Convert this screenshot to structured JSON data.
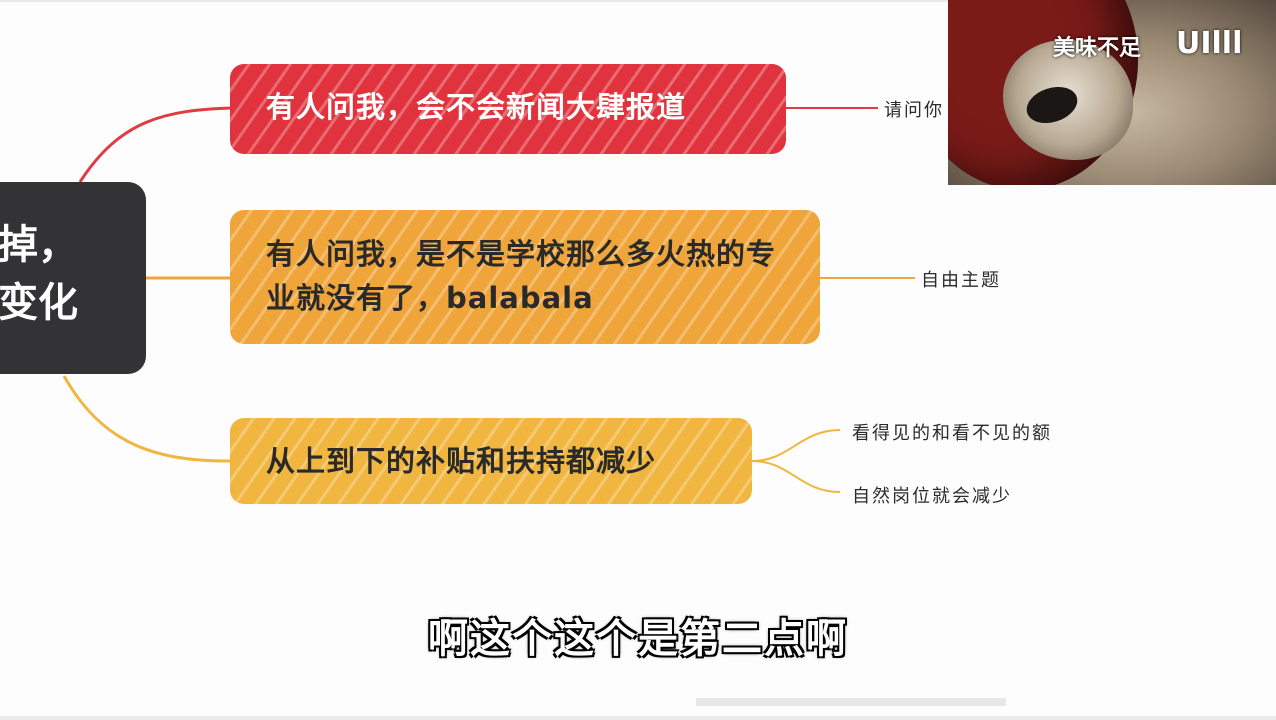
{
  "central_topic": {
    "line1": "掉，",
    "line2": "变化"
  },
  "branches": [
    {
      "text": "有人问我，会不会新闻大肆报道",
      "color": "#e1333d",
      "leaves": [
        "请问你"
      ]
    },
    {
      "text": "有人问我，是不是学校那么多火热的专业就没有了，balabala",
      "color": "#f0a53a",
      "leaves": [
        "自由主题"
      ]
    },
    {
      "text": "从上到下的补贴和扶持都减少",
      "color": "#f0b640",
      "leaves": [
        "看得见的和看不见的额",
        "自然岗位就会减少"
      ]
    }
  ],
  "webcam": {
    "caption": "美味不足",
    "logo": "UIlll"
  },
  "subtitle": "啊这个这个是第二点啊"
}
